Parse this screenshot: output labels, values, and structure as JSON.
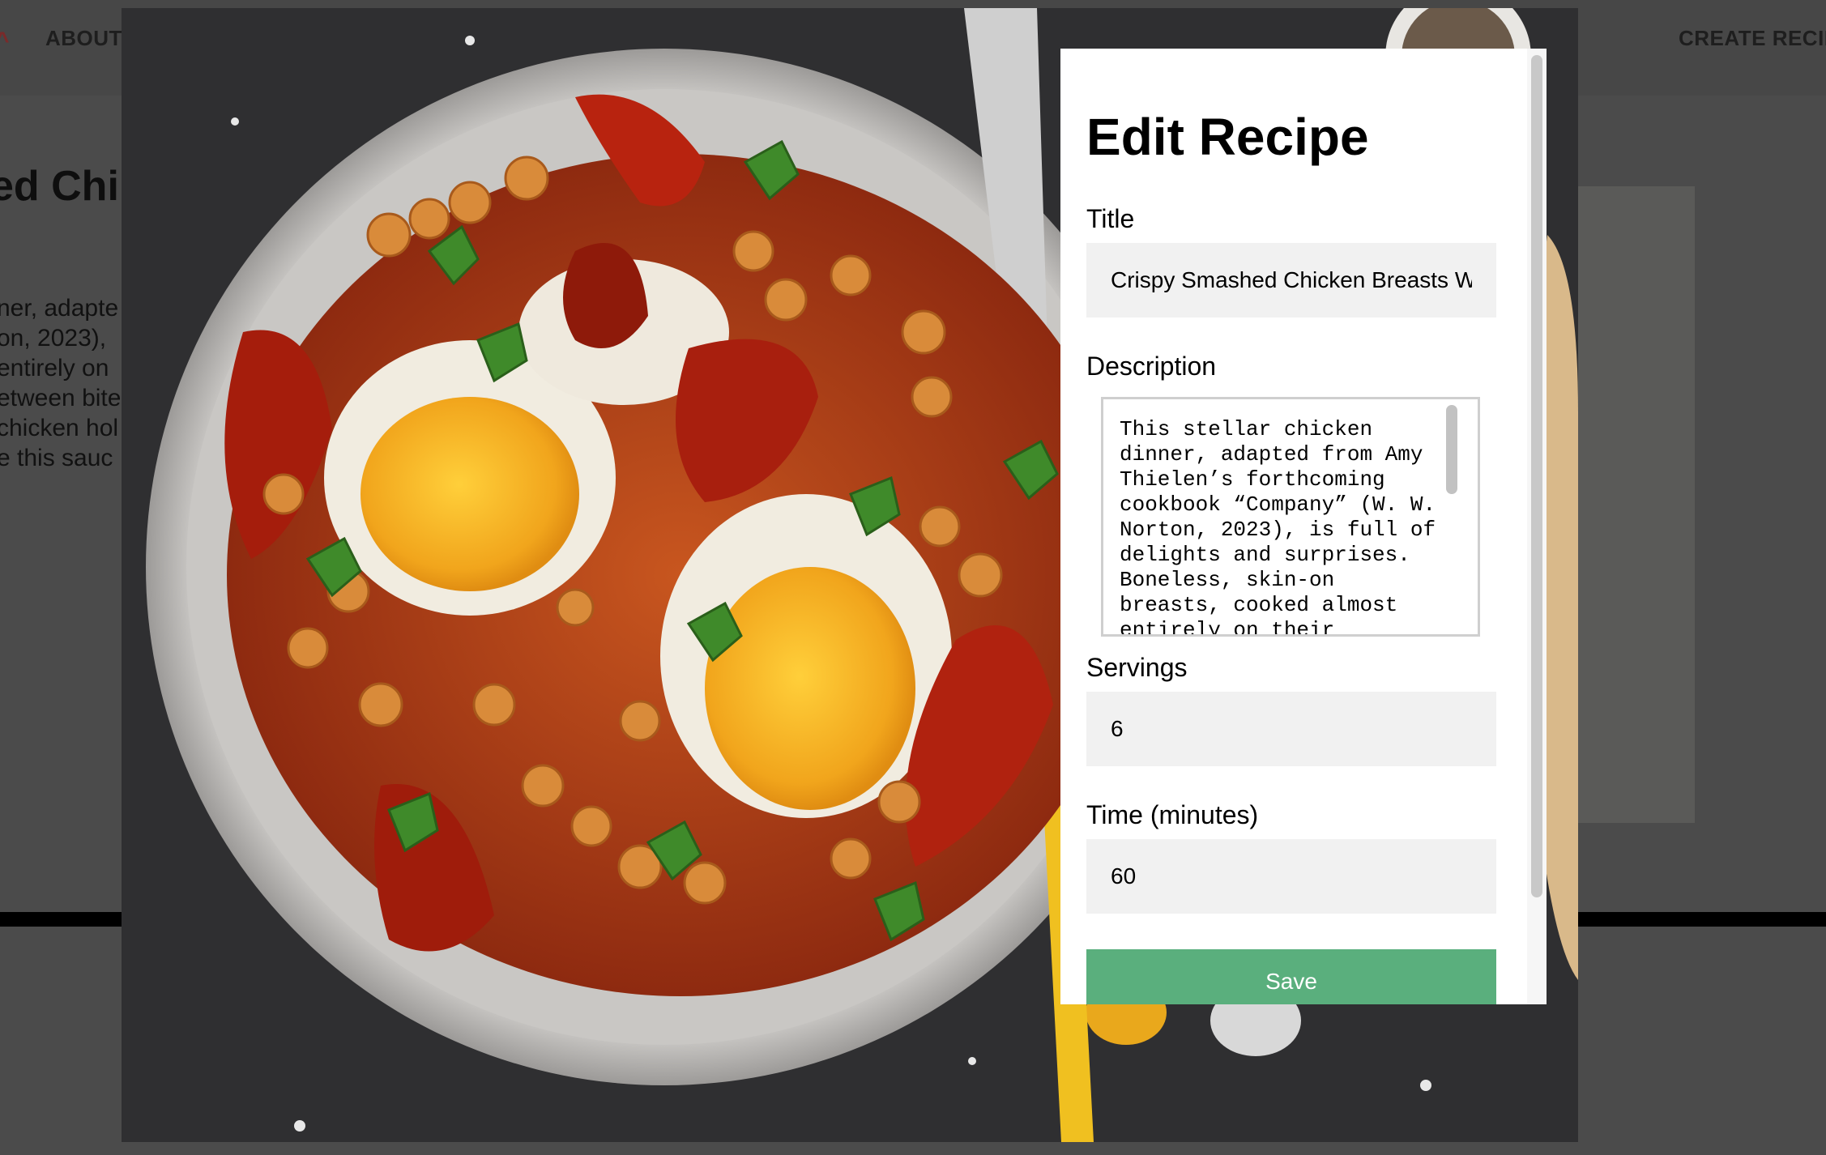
{
  "background_page": {
    "nav": {
      "logo": "^",
      "about": "ABOUT",
      "create": "CREATE RECIPE"
    },
    "title_partial": "ed Chic",
    "description_lines": [
      "ner, adapte",
      "on, 2023),",
      "entirely on",
      "etween bite",
      "chicken hol",
      "e this sauc"
    ]
  },
  "modal": {
    "form_title": "Edit Recipe",
    "fields": {
      "title_label": "Title",
      "title_value": "Crispy Smashed Chicken Breasts With",
      "description_label": "Description",
      "description_value": "This stellar chicken dinner, adapted from Amy Thielen’s forthcoming cookbook “Company” (W. W. Norton, 2023), is full of delights and surprises. Boneless, skin-on breasts, cooked almost entirely on their",
      "servings_label": "Servings",
      "servings_value": "6",
      "time_label": "Time (minutes)",
      "time_value": "60"
    },
    "save_label": "Save"
  },
  "colors": {
    "save_button": "#5aaf7d",
    "overlay": "#4b4b4b",
    "input_bg": "#f1f1f1"
  }
}
